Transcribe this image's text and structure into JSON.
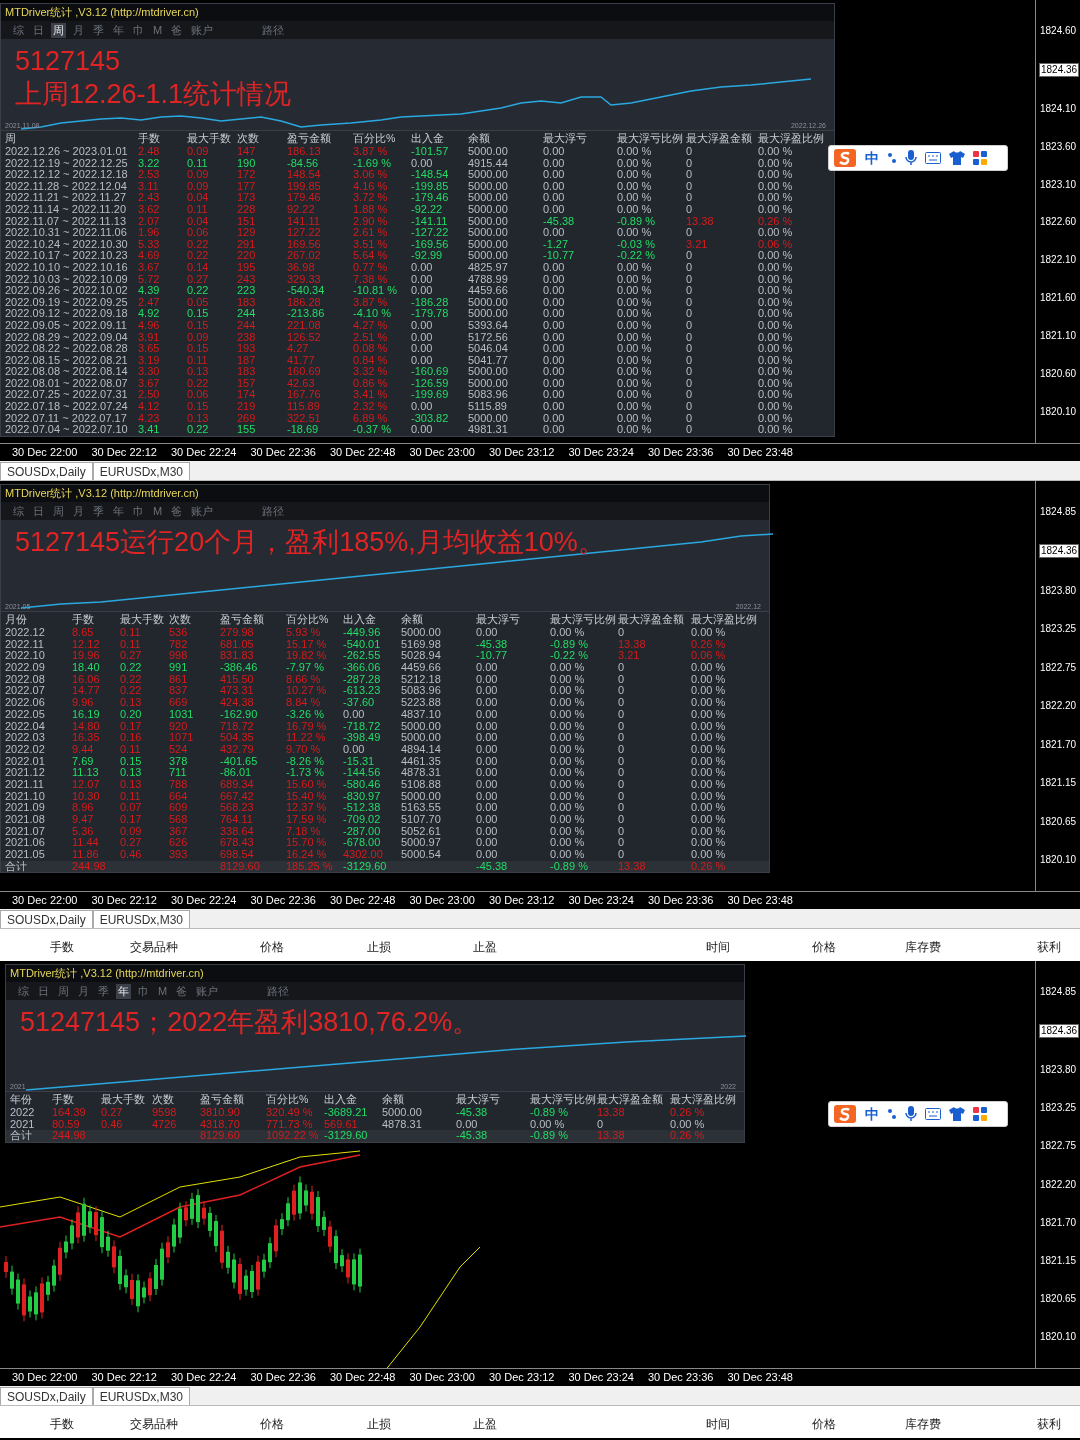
{
  "sections": [
    {
      "panel": {
        "title": "MTDriver统计 ,V3.12 (http://mtdriver.cn)",
        "tabs": [
          {
            "label": "综",
            "selected": false
          },
          {
            "label": "日",
            "selected": false
          },
          {
            "label": "周",
            "selected": true
          },
          {
            "label": "月",
            "selected": false
          },
          {
            "label": "季",
            "selected": false
          },
          {
            "label": "年",
            "selected": false
          },
          {
            "label": "巾",
            "selected": false
          },
          {
            "label": "M",
            "selected": false
          },
          {
            "label": "爸",
            "selected": false
          },
          {
            "label": "账户",
            "selected": false
          },
          {
            "label": "路径",
            "selected": false
          }
        ],
        "annotation": [
          "5127145",
          "上周12.26-1.1统计情况"
        ],
        "chart_start": "2021.11.08",
        "chart_end": "2022.12.26",
        "columns": [
          "周",
          "手数",
          "最大手数",
          "次数",
          "盈亏金额",
          "百分比%",
          "出入金",
          "余额",
          "最大浮亏",
          "最大浮亏比例",
          "最大浮盈金额",
          "最大浮盈比例"
        ],
        "rows": [
          {
            "profit": true,
            "withdrawal": true,
            "deposit": false,
            "float_loss": false,
            "float_profit": false,
            "cells": [
              "2022.12.26 ~ 2023.01.01",
              "2.48",
              "0.09",
              "147",
              "186.13",
              "3.87 %",
              "-101.57",
              "5000.00",
              "0.00",
              "0.00 %",
              "0",
              "0.00 %"
            ]
          },
          {
            "profit": false,
            "withdrawal": false,
            "deposit": false,
            "float_loss": false,
            "float_profit": false,
            "cells": [
              "2022.12.19 ~ 2022.12.25",
              "3.22",
              "0.11",
              "190",
              "-84.56",
              "-1.69 %",
              "0.00",
              "4915.44",
              "0.00",
              "0.00 %",
              "0",
              "0.00 %"
            ]
          },
          {
            "profit": true,
            "withdrawal": true,
            "deposit": false,
            "float_loss": false,
            "float_profit": false,
            "cells": [
              "2022.12.12 ~ 2022.12.18",
              "2.53",
              "0.09",
              "172",
              "148.54",
              "3.06 %",
              "-148.54",
              "5000.00",
              "0.00",
              "0.00 %",
              "0",
              "0.00 %"
            ]
          },
          {
            "profit": true,
            "withdrawal": true,
            "deposit": false,
            "float_loss": false,
            "float_profit": false,
            "cells": [
              "2022.11.28 ~ 2022.12.04",
              "3.11",
              "0.09",
              "177",
              "199.85",
              "4.16 %",
              "-199.85",
              "5000.00",
              "0.00",
              "0.00 %",
              "0",
              "0.00 %"
            ]
          },
          {
            "profit": true,
            "withdrawal": true,
            "deposit": false,
            "float_loss": false,
            "float_profit": false,
            "cells": [
              "2022.11.21 ~ 2022.11.27",
              "2.43",
              "0.04",
              "173",
              "179.46",
              "3.72 %",
              "-179.46",
              "5000.00",
              "0.00",
              "0.00 %",
              "0",
              "0.00 %"
            ]
          },
          {
            "profit": true,
            "withdrawal": true,
            "deposit": false,
            "float_loss": false,
            "float_profit": false,
            "cells": [
              "2022.11.14 ~ 2022.11.20",
              "3.62",
              "0.11",
              "228",
              "92.22",
              "1.88 %",
              "-92.22",
              "5000.00",
              "0.00",
              "0.00 %",
              "0",
              "0.00 %"
            ]
          },
          {
            "profit": true,
            "withdrawal": true,
            "deposit": false,
            "float_loss": true,
            "float_profit": true,
            "cells": [
              "2022.11.07 ~ 2022.11.13",
              "2.07",
              "0.04",
              "151",
              "141.11",
              "2.90 %",
              "-141.11",
              "5000.00",
              "-45.38",
              "-0.89 %",
              "13.38",
              "0.26 %"
            ]
          },
          {
            "profit": true,
            "withdrawal": true,
            "deposit": false,
            "float_loss": false,
            "float_profit": false,
            "cells": [
              "2022.10.31 ~ 2022.11.06",
              "1.96",
              "0.06",
              "129",
              "127.22",
              "2.61 %",
              "-127.22",
              "5000.00",
              "0.00",
              "0.00 %",
              "0",
              "0.00 %"
            ]
          },
          {
            "profit": true,
            "withdrawal": true,
            "deposit": false,
            "float_loss": true,
            "float_profit": true,
            "cells": [
              "2022.10.24 ~ 2022.10.30",
              "5.33",
              "0.22",
              "291",
              "169.56",
              "3.51 %",
              "-169.56",
              "5000.00",
              "-1.27",
              "-0.03 %",
              "3.21",
              "0.06 %"
            ]
          },
          {
            "profit": true,
            "withdrawal": true,
            "deposit": false,
            "float_loss": true,
            "float_profit": false,
            "cells": [
              "2022.10.17 ~ 2022.10.23",
              "4.69",
              "0.22",
              "220",
              "267.02",
              "5.64 %",
              "-92.99",
              "5000.00",
              "-10.77",
              "-0.22 %",
              "0",
              "0.00 %"
            ]
          },
          {
            "profit": true,
            "withdrawal": false,
            "deposit": false,
            "float_loss": false,
            "float_profit": false,
            "cells": [
              "2022.10.10 ~ 2022.10.16",
              "3.67",
              "0.14",
              "195",
              "36.98",
              "0.77 %",
              "0.00",
              "4825.97",
              "0.00",
              "0.00 %",
              "0",
              "0.00 %"
            ]
          },
          {
            "profit": true,
            "withdrawal": false,
            "deposit": false,
            "float_loss": false,
            "float_profit": false,
            "cells": [
              "2022.10.03 ~ 2022.10.09",
              "5.72",
              "0.27",
              "243",
              "329.33",
              "7.38 %",
              "0.00",
              "4788.99",
              "0.00",
              "0.00 %",
              "0",
              "0.00 %"
            ]
          },
          {
            "profit": false,
            "withdrawal": false,
            "deposit": false,
            "float_loss": false,
            "float_profit": false,
            "cells": [
              "2022.09.26 ~ 2022.10.02",
              "4.39",
              "0.22",
              "223",
              "-540.34",
              "-10.81 %",
              "0.00",
              "4459.66",
              "0.00",
              "0.00 %",
              "0",
              "0.00 %"
            ]
          },
          {
            "profit": true,
            "withdrawal": true,
            "deposit": false,
            "float_loss": false,
            "float_profit": false,
            "cells": [
              "2022.09.19 ~ 2022.09.25",
              "2.47",
              "0.05",
              "183",
              "186.28",
              "3.87 %",
              "-186.28",
              "5000.00",
              "0.00",
              "0.00 %",
              "0",
              "0.00 %"
            ]
          },
          {
            "profit": false,
            "withdrawal": true,
            "deposit": false,
            "float_loss": false,
            "float_profit": false,
            "cells": [
              "2022.09.12 ~ 2022.09.18",
              "4.92",
              "0.15",
              "244",
              "-213.86",
              "-4.10 %",
              "-179.78",
              "5000.00",
              "0.00",
              "0.00 %",
              "0",
              "0.00 %"
            ]
          },
          {
            "profit": true,
            "withdrawal": false,
            "deposit": false,
            "float_loss": false,
            "float_profit": false,
            "cells": [
              "2022.09.05 ~ 2022.09.11",
              "4.96",
              "0.15",
              "244",
              "221.08",
              "4.27 %",
              "0.00",
              "5393.64",
              "0.00",
              "0.00 %",
              "0",
              "0.00 %"
            ]
          },
          {
            "profit": true,
            "withdrawal": false,
            "deposit": false,
            "float_loss": false,
            "float_profit": false,
            "cells": [
              "2022.08.29 ~ 2022.09.04",
              "3.91",
              "0.09",
              "238",
              "126.52",
              "2.51 %",
              "0.00",
              "5172.56",
              "0.00",
              "0.00 %",
              "0",
              "0.00 %"
            ]
          },
          {
            "profit": true,
            "withdrawal": false,
            "deposit": false,
            "float_loss": false,
            "float_profit": false,
            "cells": [
              "2022.08.22 ~ 2022.08.28",
              "3.65",
              "0.15",
              "193",
              "4.27",
              "0.08 %",
              "0.00",
              "5046.04",
              "0.00",
              "0.00 %",
              "0",
              "0.00 %"
            ]
          },
          {
            "profit": true,
            "withdrawal": false,
            "deposit": false,
            "float_loss": false,
            "float_profit": false,
            "cells": [
              "2022.08.15 ~ 2022.08.21",
              "3.19",
              "0.11",
              "187",
              "41.77",
              "0.84 %",
              "0.00",
              "5041.77",
              "0.00",
              "0.00 %",
              "0",
              "0.00 %"
            ]
          },
          {
            "profit": true,
            "withdrawal": true,
            "deposit": false,
            "float_loss": false,
            "float_profit": false,
            "cells": [
              "2022.08.08 ~ 2022.08.14",
              "3.30",
              "0.13",
              "183",
              "160.69",
              "3.32 %",
              "-160.69",
              "5000.00",
              "0.00",
              "0.00 %",
              "0",
              "0.00 %"
            ]
          },
          {
            "profit": true,
            "withdrawal": true,
            "deposit": false,
            "float_loss": false,
            "float_profit": false,
            "cells": [
              "2022.08.01 ~ 2022.08.07",
              "3.67",
              "0.22",
              "157",
              "42.63",
              "0.86 %",
              "-126.59",
              "5000.00",
              "0.00",
              "0.00 %",
              "0",
              "0.00 %"
            ]
          },
          {
            "profit": true,
            "withdrawal": true,
            "deposit": false,
            "float_loss": false,
            "float_profit": false,
            "cells": [
              "2022.07.25 ~ 2022.07.31",
              "2.50",
              "0.06",
              "174",
              "167.76",
              "3.41 %",
              "-199.69",
              "5083.96",
              "0.00",
              "0.00 %",
              "0",
              "0.00 %"
            ]
          },
          {
            "profit": true,
            "withdrawal": false,
            "deposit": false,
            "float_loss": false,
            "float_profit": false,
            "cells": [
              "2022.07.18 ~ 2022.07.24",
              "4.12",
              "0.15",
              "219",
              "115.89",
              "2.32 %",
              "0.00",
              "5115.89",
              "0.00",
              "0.00 %",
              "0",
              "0.00 %"
            ]
          },
          {
            "profit": true,
            "withdrawal": true,
            "deposit": false,
            "float_loss": false,
            "float_profit": false,
            "cells": [
              "2022.07.11 ~ 2022.07.17",
              "4.23",
              "0.13",
              "269",
              "322.51",
              "6.89 %",
              "-303.82",
              "5000.00",
              "0.00",
              "0.00 %",
              "0",
              "0.00 %"
            ]
          },
          {
            "profit": false,
            "withdrawal": false,
            "deposit": false,
            "float_loss": false,
            "float_profit": false,
            "cells": [
              "2022.07.04 ~ 2022.07.10",
              "3.41",
              "0.22",
              "155",
              "-18.69",
              "-0.37 %",
              "0.00",
              "4981.31",
              "0.00",
              "0.00 %",
              "0",
              "0.00 %"
            ]
          }
        ]
      },
      "ime_toolbar": {
        "label": "中"
      },
      "price_labels": [
        {
          "text": "1824.60",
          "current": false
        },
        {
          "text": "1824.36",
          "current": true
        },
        {
          "text": "1824.10",
          "current": false
        },
        {
          "text": "1823.60",
          "current": false
        },
        {
          "text": "1823.10",
          "current": false
        },
        {
          "text": "1822.60",
          "current": false
        },
        {
          "text": "1822.10",
          "current": false
        },
        {
          "text": "1821.60",
          "current": false
        },
        {
          "text": "1821.10",
          "current": false
        },
        {
          "text": "1820.60",
          "current": false
        },
        {
          "text": "1820.10",
          "current": false
        }
      ],
      "time_axis": [
        "30 Dec 22:00",
        "30 Dec 22:12",
        "30 Dec 22:24",
        "30 Dec 22:36",
        "30 Dec 22:48",
        "30 Dec 23:00",
        "30 Dec 23:12",
        "30 Dec 23:24",
        "30 Dec 23:36",
        "30 Dec 23:48"
      ],
      "symbol_tabs": [
        "SOUSDx,Daily",
        "EURUSDx,M30"
      ]
    },
    {
      "panel": {
        "title": "MTDriver统计 ,V3.12 (http://mtdriver.cn)",
        "tabs": [
          {
            "label": "综",
            "selected": false
          },
          {
            "label": "日",
            "selected": false
          },
          {
            "label": "周",
            "selected": false
          },
          {
            "label": "月",
            "selected": false
          },
          {
            "label": "季",
            "selected": false
          },
          {
            "label": "年",
            "selected": false
          },
          {
            "label": "巾",
            "selected": false
          },
          {
            "label": "M",
            "selected": false
          },
          {
            "label": "爸",
            "selected": false
          },
          {
            "label": "账户",
            "selected": false
          },
          {
            "label": "路径",
            "selected": false
          }
        ],
        "annotation": [
          "5127145运行20个月，盈利185%,月均收益10%。"
        ],
        "chart_start": "2021.05",
        "chart_end": "2022.12",
        "columns": [
          "月份",
          "手数",
          "最大手数",
          "次数",
          "盈亏金额",
          "百分比%",
          "出入金",
          "余额",
          "最大浮亏",
          "最大浮亏比例",
          "最大浮盈金额",
          "最大浮盈比例"
        ],
        "rows": [
          {
            "profit": true,
            "withdrawal": true,
            "deposit": false,
            "float_loss": false,
            "float_profit": false,
            "cells": [
              "2022.12",
              "8.65",
              "0.11",
              "536",
              "279.98",
              "5.93 %",
              "-449.96",
              "5000.00",
              "0.00",
              "0.00 %",
              "0",
              "0.00 %"
            ]
          },
          {
            "profit": true,
            "withdrawal": true,
            "deposit": false,
            "float_loss": true,
            "float_profit": true,
            "cells": [
              "2022.11",
              "12.12",
              "0.11",
              "782",
              "681.05",
              "15.17 %",
              "-540.01",
              "5169.98",
              "-45.38",
              "-0.89 %",
              "13.38",
              "0.26 %"
            ]
          },
          {
            "profit": true,
            "withdrawal": true,
            "deposit": false,
            "float_loss": true,
            "float_profit": true,
            "cells": [
              "2022.10",
              "19.96",
              "0.27",
              "998",
              "831.83",
              "19.82 %",
              "-262.55",
              "5028.94",
              "-10.77",
              "-0.22 %",
              "3.21",
              "0.06 %"
            ]
          },
          {
            "profit": false,
            "withdrawal": true,
            "deposit": false,
            "float_loss": false,
            "float_profit": false,
            "cells": [
              "2022.09",
              "18.40",
              "0.22",
              "991",
              "-386.46",
              "-7.97 %",
              "-366.06",
              "4459.66",
              "0.00",
              "0.00 %",
              "0",
              "0.00 %"
            ]
          },
          {
            "profit": true,
            "withdrawal": true,
            "deposit": false,
            "float_loss": false,
            "float_profit": false,
            "cells": [
              "2022.08",
              "16.06",
              "0.22",
              "861",
              "415.50",
              "8.66 %",
              "-287.28",
              "5212.18",
              "0.00",
              "0.00 %",
              "0",
              "0.00 %"
            ]
          },
          {
            "profit": true,
            "withdrawal": true,
            "deposit": false,
            "float_loss": false,
            "float_profit": false,
            "cells": [
              "2022.07",
              "14.77",
              "0.22",
              "837",
              "473.31",
              "10.27 %",
              "-613.23",
              "5083.96",
              "0.00",
              "0.00 %",
              "0",
              "0.00 %"
            ]
          },
          {
            "profit": true,
            "withdrawal": true,
            "deposit": false,
            "float_loss": false,
            "float_profit": false,
            "cells": [
              "2022.06",
              "9.96",
              "0.13",
              "669",
              "424.38",
              "8.84 %",
              "-37.60",
              "5223.88",
              "0.00",
              "0.00 %",
              "0",
              "0.00 %"
            ]
          },
          {
            "profit": false,
            "withdrawal": false,
            "deposit": false,
            "float_loss": false,
            "float_profit": false,
            "cells": [
              "2022.05",
              "16.19",
              "0.20",
              "1031",
              "-162.90",
              "-3.26 %",
              "0.00",
              "4837.10",
              "0.00",
              "0.00 %",
              "0",
              "0.00 %"
            ]
          },
          {
            "profit": true,
            "withdrawal": true,
            "deposit": false,
            "float_loss": false,
            "float_profit": false,
            "cells": [
              "2022.04",
              "14.80",
              "0.17",
              "920",
              "718.72",
              "16.79 %",
              "-718.72",
              "5000.00",
              "0.00",
              "0.00 %",
              "0",
              "0.00 %"
            ]
          },
          {
            "profit": true,
            "withdrawal": true,
            "deposit": false,
            "float_loss": false,
            "float_profit": false,
            "cells": [
              "2022.03",
              "16.35",
              "0.16",
              "1071",
              "504.35",
              "11.22 %",
              "-398.49",
              "5000.00",
              "0.00",
              "0.00 %",
              "0",
              "0.00 %"
            ]
          },
          {
            "profit": true,
            "withdrawal": false,
            "deposit": false,
            "float_loss": false,
            "float_profit": false,
            "cells": [
              "2022.02",
              "9.44",
              "0.11",
              "524",
              "432.79",
              "9.70 %",
              "0.00",
              "4894.14",
              "0.00",
              "0.00 %",
              "0",
              "0.00 %"
            ]
          },
          {
            "profit": false,
            "withdrawal": true,
            "deposit": false,
            "float_loss": false,
            "float_profit": false,
            "cells": [
              "2022.01",
              "7.69",
              "0.15",
              "378",
              "-401.65",
              "-8.26 %",
              "-15.31",
              "4461.35",
              "0.00",
              "0.00 %",
              "0",
              "0.00 %"
            ]
          },
          {
            "profit": false,
            "withdrawal": true,
            "deposit": false,
            "float_loss": false,
            "float_profit": false,
            "cells": [
              "2021.12",
              "11.13",
              "0.13",
              "711",
              "-86.01",
              "-1.73 %",
              "-144.56",
              "4878.31",
              "0.00",
              "0.00 %",
              "0",
              "0.00 %"
            ]
          },
          {
            "profit": true,
            "withdrawal": true,
            "deposit": false,
            "float_loss": false,
            "float_profit": false,
            "cells": [
              "2021.11",
              "12.07",
              "0.13",
              "788",
              "689.34",
              "15.60 %",
              "-580.46",
              "5108.88",
              "0.00",
              "0.00 %",
              "0",
              "0.00 %"
            ]
          },
          {
            "profit": true,
            "withdrawal": true,
            "deposit": false,
            "float_loss": false,
            "float_profit": false,
            "cells": [
              "2021.10",
              "10.30",
              "0.11",
              "664",
              "667.42",
              "15.40 %",
              "-830.97",
              "5000.00",
              "0.00",
              "0.00 %",
              "0",
              "0.00 %"
            ]
          },
          {
            "profit": true,
            "withdrawal": true,
            "deposit": false,
            "float_loss": false,
            "float_profit": false,
            "cells": [
              "2021.09",
              "8.96",
              "0.07",
              "609",
              "568.23",
              "12.37 %",
              "-512.38",
              "5163.55",
              "0.00",
              "0.00 %",
              "0",
              "0.00 %"
            ]
          },
          {
            "profit": true,
            "withdrawal": true,
            "deposit": false,
            "float_loss": false,
            "float_profit": false,
            "cells": [
              "2021.08",
              "9.47",
              "0.17",
              "568",
              "764.11",
              "17.59 %",
              "-709.02",
              "5107.70",
              "0.00",
              "0.00 %",
              "0",
              "0.00 %"
            ]
          },
          {
            "profit": true,
            "withdrawal": true,
            "deposit": false,
            "float_loss": false,
            "float_profit": false,
            "cells": [
              "2021.07",
              "5.36",
              "0.09",
              "367",
              "338.64",
              "7.18 %",
              "-287.00",
              "5052.61",
              "0.00",
              "0.00 %",
              "0",
              "0.00 %"
            ]
          },
          {
            "profit": true,
            "withdrawal": true,
            "deposit": false,
            "float_loss": false,
            "float_profit": false,
            "cells": [
              "2021.06",
              "11.44",
              "0.27",
              "626",
              "678.43",
              "15.70 %",
              "-678.00",
              "5000.97",
              "0.00",
              "0.00 %",
              "0",
              "0.00 %"
            ]
          },
          {
            "profit": true,
            "withdrawal": false,
            "deposit": true,
            "float_loss": false,
            "float_profit": false,
            "cells": [
              "2021.05",
              "11.86",
              "0.46",
              "393",
              "698.54",
              "16.24 %",
              "4302.00",
              "5000.54",
              "0.00",
              "0.00 %",
              "0",
              "0.00 %"
            ]
          }
        ],
        "total": {
          "profit": true,
          "withdrawal": true,
          "deposit": false,
          "float_loss": true,
          "float_profit": true,
          "cells": [
            "合计",
            "244.98",
            "8129.60",
            "185.25 %",
            "-3129.60",
            "-45.38",
            "-0.89 %",
            "13.38",
            "0.26 %"
          ]
        }
      },
      "price_labels": [
        {
          "text": "1824.85",
          "current": false
        },
        {
          "text": "1824.36",
          "current": true
        },
        {
          "text": "1823.80",
          "current": false
        },
        {
          "text": "1823.25",
          "current": false
        },
        {
          "text": "1822.75",
          "current": false
        },
        {
          "text": "1822.20",
          "current": false
        },
        {
          "text": "1821.70",
          "current": false
        },
        {
          "text": "1821.15",
          "current": false
        },
        {
          "text": "1820.65",
          "current": false
        },
        {
          "text": "1820.10",
          "current": false
        }
      ],
      "time_axis": [
        "30 Dec 22:00",
        "30 Dec 22:12",
        "30 Dec 22:24",
        "30 Dec 22:36",
        "30 Dec 22:48",
        "30 Dec 23:00",
        "30 Dec 23:12",
        "30 Dec 23:24",
        "30 Dec 23:36",
        "30 Dec 23:48"
      ],
      "symbol_tabs": [
        "SOUSDx,Daily",
        "EURUSDx,M30"
      ],
      "terminal_columns": [
        "手数",
        "交易品种",
        "价格",
        "止损",
        "止盈",
        "时间",
        "价格",
        "库存费",
        "获利"
      ]
    },
    {
      "panel": {
        "title": "MTDriver统计 ,V3.12 (http://mtdriver.cn)",
        "tabs": [
          {
            "label": "综",
            "selected": false
          },
          {
            "label": "日",
            "selected": false
          },
          {
            "label": "周",
            "selected": false
          },
          {
            "label": "月",
            "selected": false
          },
          {
            "label": "季",
            "selected": false
          },
          {
            "label": "年",
            "selected": true
          },
          {
            "label": "巾",
            "selected": false
          },
          {
            "label": "M",
            "selected": false
          },
          {
            "label": "爸",
            "selected": false
          },
          {
            "label": "账户",
            "selected": false
          },
          {
            "label": "路径",
            "selected": false
          }
        ],
        "annotation": [
          "51247145；2022年盈利3810,76.2%。"
        ],
        "chart_start": "2021",
        "chart_end": "2022",
        "columns": [
          "年份",
          "手数",
          "最大手数",
          "次数",
          "盈亏金额",
          "百分比%",
          "出入金",
          "余额",
          "最大浮亏",
          "最大浮亏比例",
          "最大浮盈金额",
          "最大浮盈比例"
        ],
        "rows": [
          {
            "profit": true,
            "withdrawal": true,
            "deposit": false,
            "float_loss": true,
            "float_profit": true,
            "cells": [
              "2022",
              "164.39",
              "0.27",
              "9598",
              "3810.90",
              "320.49 %",
              "-3689.21",
              "5000.00",
              "-45.38",
              "-0.89 %",
              "13.38",
              "0.26 %"
            ]
          },
          {
            "profit": true,
            "withdrawal": false,
            "deposit": true,
            "float_loss": false,
            "float_profit": false,
            "cells": [
              "2021",
              "80.59",
              "0.46",
              "4726",
              "4318.70",
              "771.73 %",
              "569.61",
              "4878.31",
              "0.00",
              "0.00 %",
              "0",
              "0.00 %"
            ]
          }
        ],
        "total": {
          "profit": true,
          "withdrawal": true,
          "deposit": false,
          "float_loss": true,
          "float_profit": true,
          "cells": [
            "合计",
            "244.98",
            "8129.60",
            "1092.22 %",
            "-3129.60",
            "-45.38",
            "-0.89 %",
            "13.38",
            "0.26 %"
          ]
        }
      },
      "ime_toolbar": {
        "label": "中"
      },
      "price_labels": [
        {
          "text": "1824.85",
          "current": false
        },
        {
          "text": "1824.36",
          "current": true
        },
        {
          "text": "1823.80",
          "current": false
        },
        {
          "text": "1823.25",
          "current": false
        },
        {
          "text": "1822.75",
          "current": false
        },
        {
          "text": "1822.20",
          "current": false
        },
        {
          "text": "1821.70",
          "current": false
        },
        {
          "text": "1821.15",
          "current": false
        },
        {
          "text": "1820.65",
          "current": false
        },
        {
          "text": "1820.10",
          "current": false
        }
      ],
      "time_axis": [
        "30 Dec 22:00",
        "30 Dec 22:12",
        "30 Dec 22:24",
        "30 Dec 22:36",
        "30 Dec 22:48",
        "30 Dec 23:00",
        "30 Dec 23:12",
        "30 Dec 23:24",
        "30 Dec 23:36",
        "30 Dec 23:48"
      ],
      "symbol_tabs": [
        "SOUSDx,Daily",
        "EURUSDx,M30"
      ],
      "terminal_columns": [
        "手数",
        "交易品种",
        "价格",
        "止损",
        "止盈",
        "时间",
        "价格",
        "库存费",
        "获利"
      ]
    }
  ]
}
